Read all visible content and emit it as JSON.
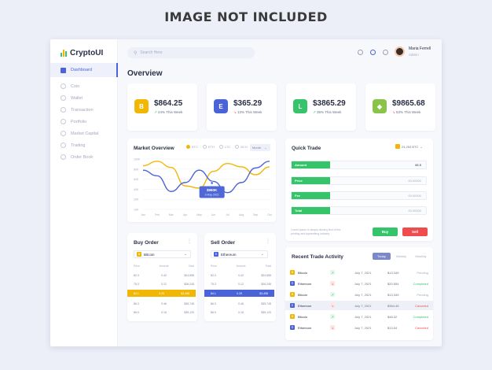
{
  "banner": "IMAGE NOT INCLUDED",
  "app": {
    "name": "CryptoUI"
  },
  "sidebar": {
    "items": [
      {
        "label": "Dashboard"
      },
      {
        "label": "Coin"
      },
      {
        "label": "Wallet"
      },
      {
        "label": "Transaction"
      },
      {
        "label": "Portfolio"
      },
      {
        "label": "Market Capital"
      },
      {
        "label": "Trading"
      },
      {
        "label": "Order Book"
      }
    ]
  },
  "header": {
    "search_placeholder": "Search Here",
    "user_name": "Maria Ferrell",
    "user_role": "Admin"
  },
  "overview": {
    "title": "Overview",
    "stats": [
      {
        "icon": "B",
        "value": "$864.25",
        "change": "24% This Week",
        "direction": "up",
        "color": "#f2b705"
      },
      {
        "icon": "E",
        "value": "$365.29",
        "change": "13% This Week",
        "direction": "down",
        "color": "#4a63d8"
      },
      {
        "icon": "L",
        "value": "$3865.29",
        "change": "35% This Week",
        "direction": "up",
        "color": "#35c46a"
      },
      {
        "icon": "◈",
        "value": "$9865.68",
        "change": "53% This Week",
        "direction": "down",
        "color": "#8ac34a"
      }
    ]
  },
  "market": {
    "title": "Market Overview",
    "legend": [
      "BTC",
      "ETH",
      "LTC",
      "BCH"
    ],
    "range": "Month",
    "tooltip_value": "$960K",
    "tooltip_date": "3 May 2021"
  },
  "chart_data": {
    "type": "line",
    "categories": [
      "Jan",
      "Feb",
      "Mar",
      "Apr",
      "May",
      "Jun",
      "Jul",
      "Aug",
      "Sep",
      "Oct"
    ],
    "yticks": [
      "100K",
      "80K",
      "60K",
      "40K",
      "20K",
      "10K"
    ],
    "ylim": [
      10,
      100
    ],
    "series": [
      {
        "name": "BTC",
        "color": "#f2b705",
        "values": [
          88,
          96,
          85,
          52,
          48,
          78,
          92,
          86,
          72,
          86
        ]
      },
      {
        "name": "ETH",
        "color": "#4a63d8",
        "values": [
          80,
          70,
          42,
          58,
          80,
          60,
          40,
          58,
          84,
          96
        ]
      }
    ]
  },
  "quick_trade": {
    "title": "Quick Trade",
    "selector": "24,253 BTC",
    "fields": [
      {
        "label": "Amount",
        "value": "65.5"
      },
      {
        "label": "Price",
        "value": "00.00000"
      },
      {
        "label": "Fee",
        "value": "00.00000"
      },
      {
        "label": "Total",
        "value": "00.00000"
      }
    ],
    "note": "Lorem ipsum is simply dummy text of the printing and typesetting industry",
    "buy_label": "Buy",
    "sell_label": "Sell"
  },
  "buy_order": {
    "title": "Buy Order",
    "coin": "Bitcoin",
    "headers": [
      "Price",
      "Amount",
      "Total"
    ],
    "rows": [
      [
        "82.3",
        "0.42",
        "$24,555"
      ],
      [
        "75.3",
        "0.12",
        "$26,245"
      ],
      [
        "84.1",
        "0.25",
        "$3,458"
      ],
      [
        "86.3",
        "0.46",
        "$35,745"
      ],
      [
        "86.9",
        "0.16",
        "$35,120"
      ]
    ],
    "highlight_row": 2
  },
  "sell_order": {
    "title": "Sell Order",
    "coin": "Ethereum",
    "headers": [
      "Price",
      "Amount",
      "Total"
    ],
    "rows": [
      [
        "82.3",
        "0.42",
        "$24,555"
      ],
      [
        "75.3",
        "0.12",
        "$26,245"
      ],
      [
        "84.1",
        "0.25",
        "$3,458"
      ],
      [
        "86.3",
        "0.46",
        "$35,745"
      ],
      [
        "86.9",
        "0.16",
        "$35,120"
      ]
    ],
    "highlight_row": 2
  },
  "recent": {
    "title": "Recent Trade Activity",
    "tabs": [
      "Today",
      "Weekly",
      "Monthly"
    ],
    "rows": [
      {
        "coin": "Bitcoin",
        "icon": "B",
        "color": "#f2b705",
        "dir": "up",
        "date": "July 7, 2021",
        "amount": "$13,349",
        "status": "Pending"
      },
      {
        "coin": "Ethereum",
        "icon": "E",
        "color": "#4a63d8",
        "dir": "down",
        "date": "July 7, 2021",
        "amount": "$20,554",
        "status": "Completed"
      },
      {
        "coin": "Bitcoin",
        "icon": "B",
        "color": "#f2b705",
        "dir": "up",
        "date": "July 7, 2021",
        "amount": "$13,349",
        "status": "Pending"
      },
      {
        "coin": "Ethereum",
        "icon": "E",
        "color": "#4a63d8",
        "dir": "down",
        "date": "July 7, 2021",
        "amount": "$364.45",
        "status": "Canceled"
      },
      {
        "coin": "Bitcoin",
        "icon": "B",
        "color": "#f2b705",
        "dir": "up",
        "date": "July 7, 2021",
        "amount": "$48.32",
        "status": "Completed"
      },
      {
        "coin": "Ethereum",
        "icon": "E",
        "color": "#4a63d8",
        "dir": "down",
        "date": "July 7, 2021",
        "amount": "$13,54",
        "status": "Canceled"
      }
    ],
    "highlight_row": 3
  }
}
